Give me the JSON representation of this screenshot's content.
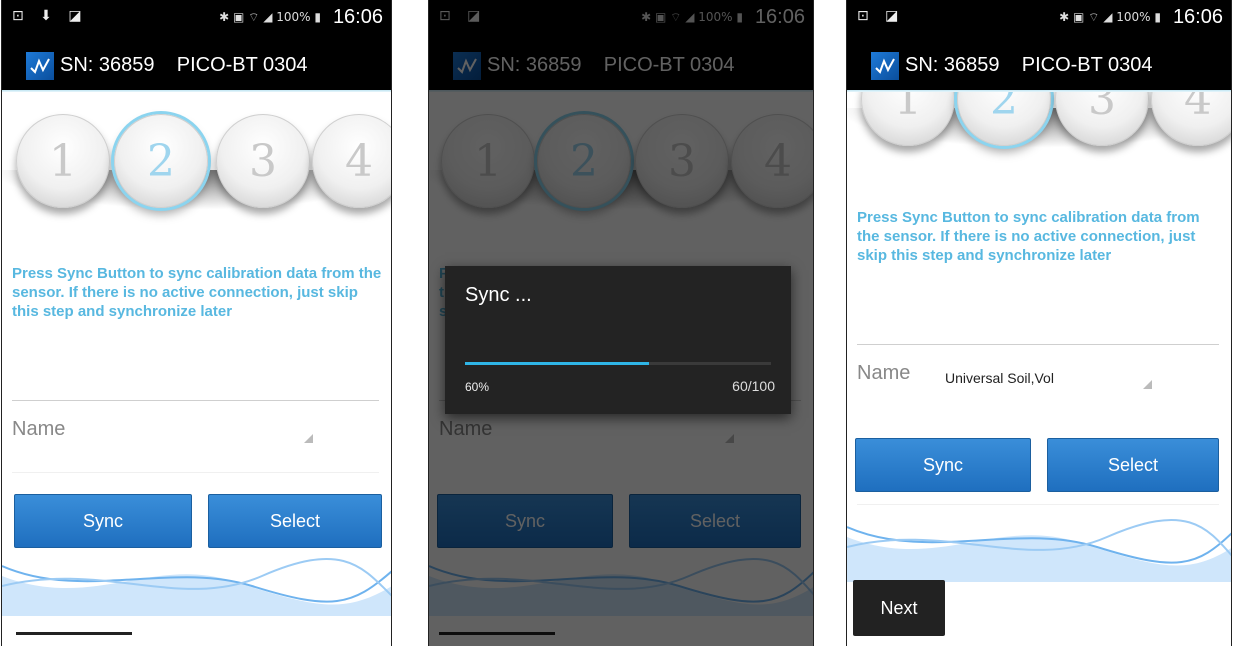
{
  "status_bar": {
    "time": "16:06",
    "battery": "100%"
  },
  "app_bar": {
    "serial": "SN: 36859",
    "device": "PICO-BT 0304"
  },
  "steps": [
    "1",
    "2",
    "3",
    "4"
  ],
  "instructions": "Press Sync Button to sync calibration data from the sensor. If there is no active connection, just skip this step and synchronize later",
  "name_label": "Name",
  "name_value_screen3": "Universal Soil,Vol",
  "buttons": {
    "sync": "Sync",
    "select": "Select",
    "next": "Next"
  },
  "sync_dialog": {
    "title": "Sync ...",
    "progress_fraction": 0.6,
    "percent_label": "60%",
    "count_label": "60/100"
  },
  "colors": {
    "accent": "#58b8e0",
    "button": "#2a7fcc",
    "bar": "#000000",
    "progress": "#2fb5e6"
  }
}
